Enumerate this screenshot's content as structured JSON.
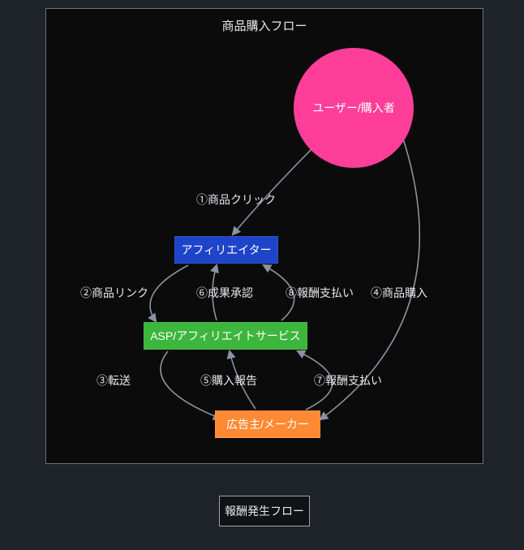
{
  "panel": {
    "title": "商品購入フロー"
  },
  "nodes": {
    "user": "ユーザー/購入者",
    "affiliator": "アフィリエイター",
    "asp": "ASP/アフィリエイトサービス",
    "advertiser": "広告主/メーカー"
  },
  "edges": {
    "e1": "①商品クリック",
    "e2": "②商品リンク",
    "e3": "③転送",
    "e4": "④商品購入",
    "e5": "⑤購入報告",
    "e6": "⑥成果承認",
    "e7": "⑦報酬支払い",
    "e8": "⑧報酬支払い"
  },
  "button2": {
    "label": "報酬発生フロー"
  },
  "colors": {
    "bg": "#1f232a",
    "panel": "#0b0b0b",
    "user": "#ff3e99",
    "affiliator": "#1d44c9",
    "asp": "#3cb63c",
    "advertiser": "#ff8a33",
    "arrow": "#8a93a2"
  }
}
